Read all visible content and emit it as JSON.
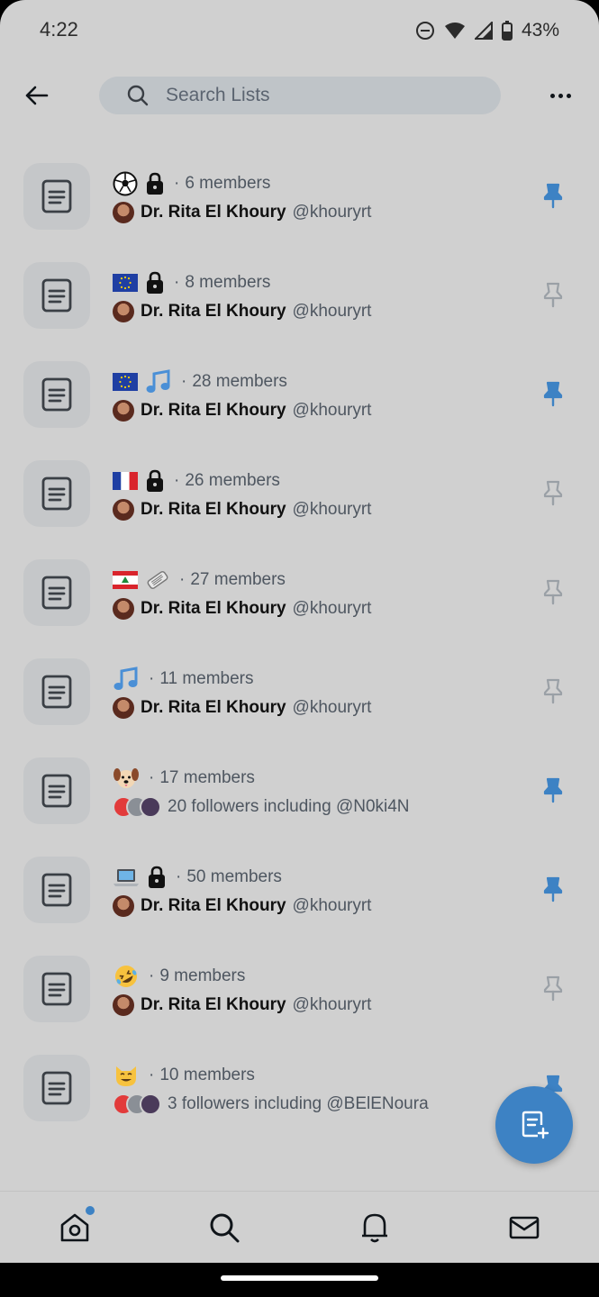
{
  "status_bar": {
    "time": "4:22",
    "battery": "43%"
  },
  "header": {
    "search_placeholder": "Search Lists"
  },
  "lists": [
    {
      "emojis": [
        "soccer-ball",
        "lock"
      ],
      "members": "6 members",
      "owner_name": "Dr. Rita El Khoury",
      "owner_handle": "@khouryrt",
      "pinned": true
    },
    {
      "emojis": [
        "eu-flag",
        "lock"
      ],
      "members": "8 members",
      "owner_name": "Dr. Rita El Khoury",
      "owner_handle": "@khouryrt",
      "pinned": false
    },
    {
      "emojis": [
        "eu-flag",
        "music-note"
      ],
      "members": "28 members",
      "owner_name": "Dr. Rita El Khoury",
      "owner_handle": "@khouryrt",
      "pinned": true
    },
    {
      "emojis": [
        "france-flag",
        "lock"
      ],
      "members": "26 members",
      "owner_name": "Dr. Rita El Khoury",
      "owner_handle": "@khouryrt",
      "pinned": false
    },
    {
      "emojis": [
        "lebanon-flag",
        "newspaper"
      ],
      "members": "27 members",
      "owner_name": "Dr. Rita El Khoury",
      "owner_handle": "@khouryrt",
      "pinned": false
    },
    {
      "emojis": [
        "music-note"
      ],
      "members": "11 members",
      "owner_name": "Dr. Rita El Khoury",
      "owner_handle": "@khouryrt",
      "pinned": false
    },
    {
      "emojis": [
        "dog-face"
      ],
      "members": "17 members",
      "followers_text": "20 followers including @N0ki4N",
      "pinned": true
    },
    {
      "emojis": [
        "laptop",
        "lock"
      ],
      "members": "50 members",
      "owner_name": "Dr. Rita El Khoury",
      "owner_handle": "@khouryrt",
      "pinned": true
    },
    {
      "emojis": [
        "rofl-face"
      ],
      "members": "9 members",
      "owner_name": "Dr. Rita El Khoury",
      "owner_handle": "@khouryrt",
      "pinned": false
    },
    {
      "emojis": [
        "cat-face"
      ],
      "members": "10 members",
      "followers_text": "3 followers including @BElENoura",
      "pinned": true
    }
  ],
  "icons": {
    "back": "arrow-left-icon",
    "search": "search-icon",
    "more": "more-horizontal-icon",
    "list": "list-doc-icon",
    "pin": "pin-icon",
    "new_list": "new-list-icon",
    "nav": [
      "home-icon",
      "search-icon",
      "bell-icon",
      "mail-icon"
    ]
  },
  "colors": {
    "accent": "#3d82c4",
    "background": "#d0d0d0",
    "pin_inactive": "#9aa0a6"
  }
}
